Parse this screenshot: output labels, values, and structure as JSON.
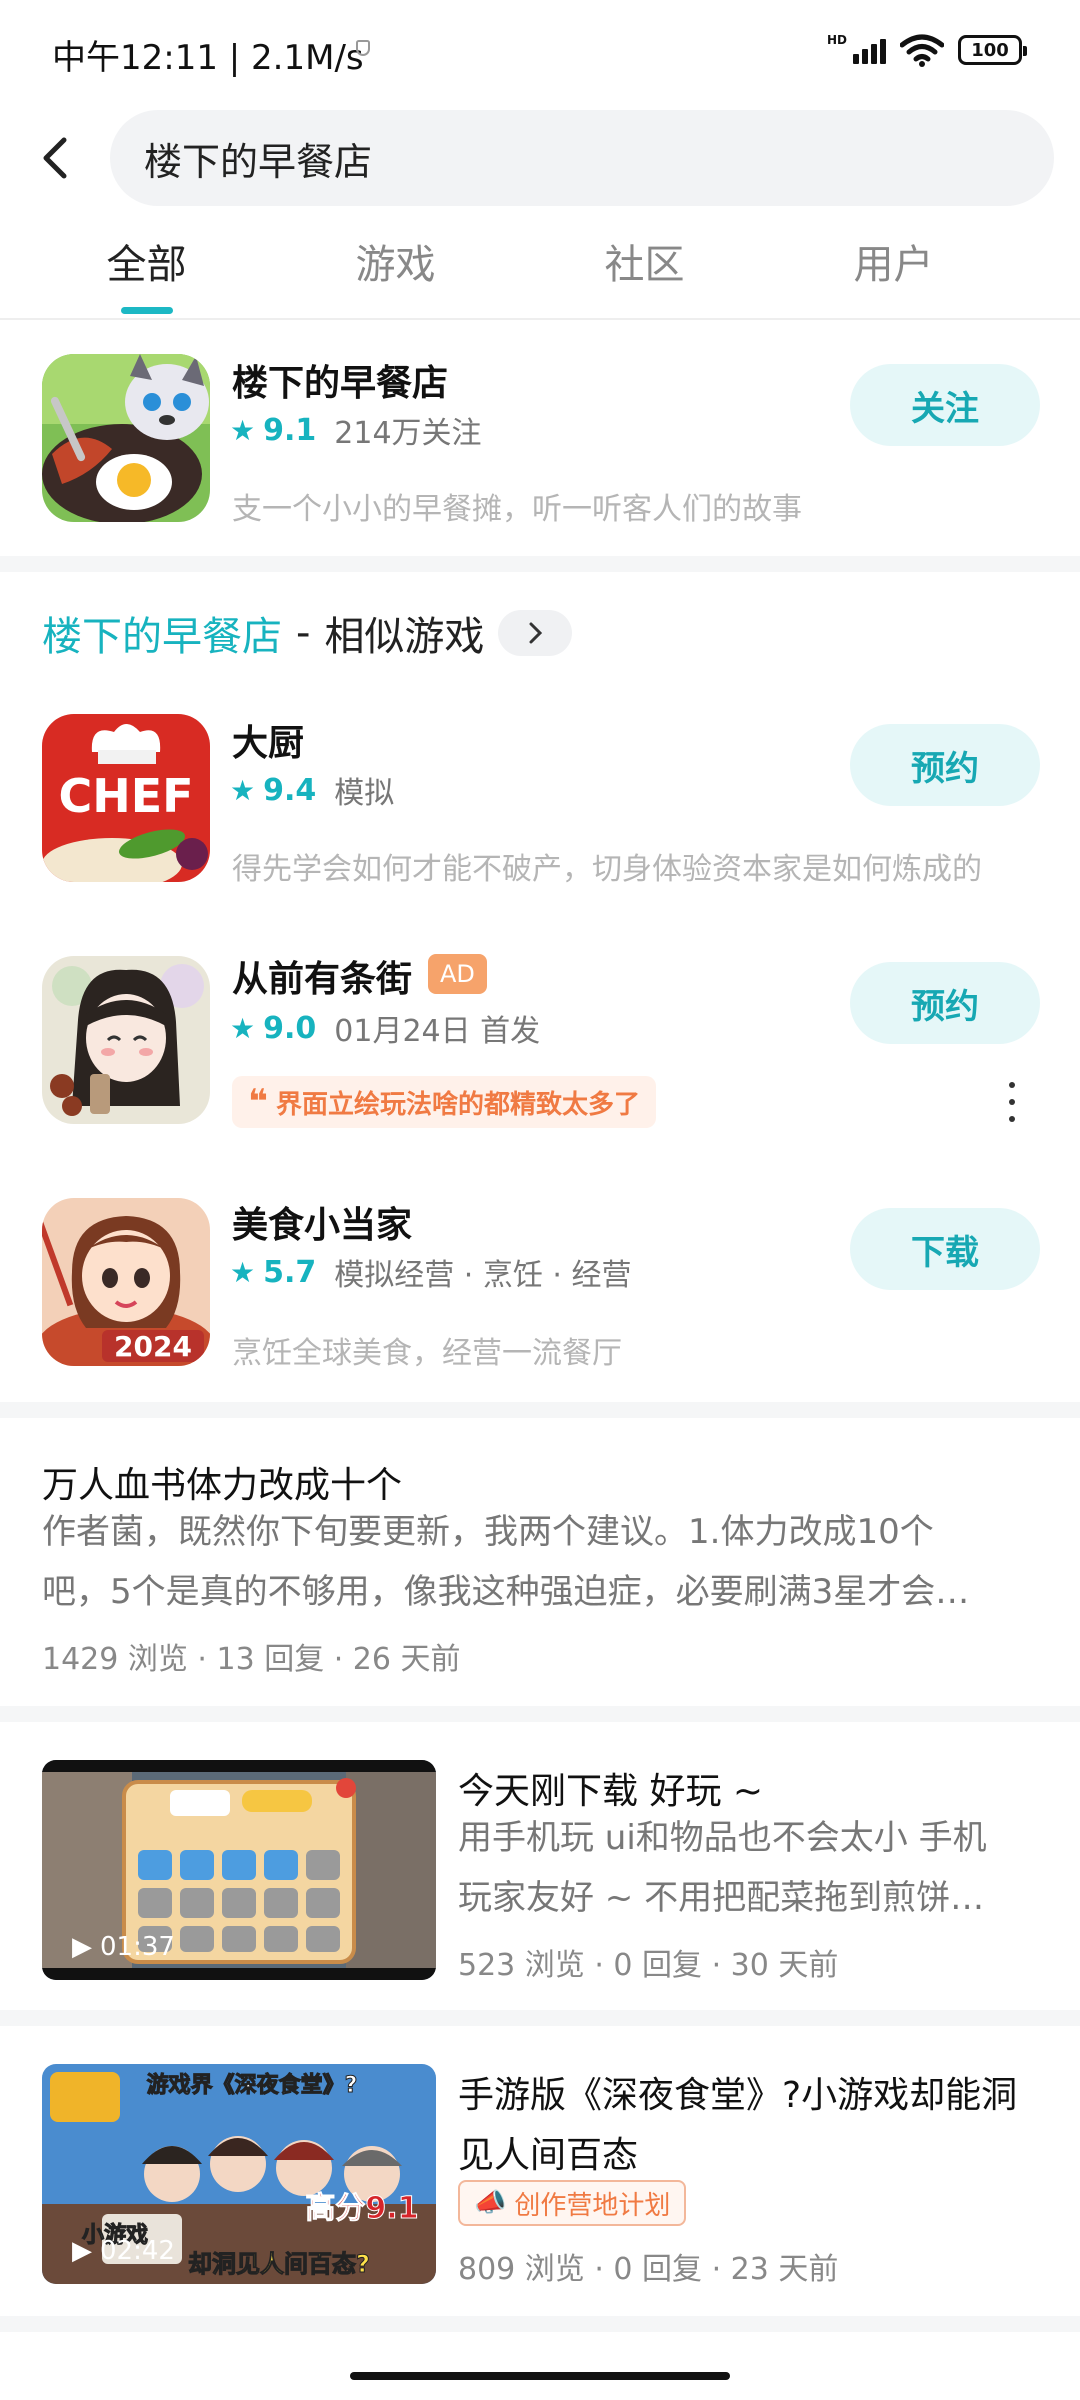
{
  "status_bar": {
    "time": "中午12:11 | 2.1M/s",
    "network": "HD",
    "battery": "100"
  },
  "search": {
    "query": "楼下的早餐店"
  },
  "tabs": [
    {
      "label": "全部",
      "active": true
    },
    {
      "label": "游戏",
      "active": false
    },
    {
      "label": "社区",
      "active": false
    },
    {
      "label": "用户",
      "active": false
    }
  ],
  "main_game": {
    "title": "楼下的早餐店",
    "rating": "9.1",
    "followers": "214万关注",
    "description": "支一个小小的早餐摊，听一听客人们的故事",
    "button": "关注"
  },
  "similar": {
    "game_name": "楼下的早餐店",
    "dash": "-",
    "suffix": "相似游戏",
    "items": [
      {
        "title": "大厨",
        "rating": "9.4",
        "meta": "模拟",
        "description": "得先学会如何才能不破产，切身体验资本家是如何炼成的",
        "button": "预约",
        "icon_text": "CHEF"
      },
      {
        "title": "从前有条街",
        "ad": "AD",
        "rating": "9.0",
        "meta": "01月24日 首发",
        "quote": "界面立绘玩法啥的都精致太多了",
        "button": "预约"
      },
      {
        "title": "美食小当家",
        "rating": "5.7",
        "meta": "模拟经营 · 烹饪 · 经营",
        "description": "烹饪全球美食，经营一流餐厅",
        "button": "下载",
        "icon_text": "2024"
      }
    ]
  },
  "posts": [
    {
      "title": "万人血书体力改成十个",
      "body_line1": "作者菌，既然你下旬要更新，我两个建议。1.体力改成10个",
      "body_line2": "吧，5个是真的不够用，像我这种强迫症，必要刷满3星才会…",
      "stats": "1429 浏览  ·  13 回复  ·  26 天前"
    },
    {
      "title": "今天刚下载 好玩 ~",
      "body_line1": "用手机玩 ui和物品也不会太小 手机",
      "body_line2": "玩家友好 ~  不用把配菜拖到煎饼…",
      "stats": "523 浏览  ·  0 回复  ·  30 天前",
      "duration": "01:37"
    },
    {
      "title_line1": "手游版《深夜食堂》?小游戏却能洞",
      "title_line2": "见人间百态",
      "chip": "创作营地计划",
      "stats": "809 浏览  ·  0 回复  ·  23 天前",
      "duration": "02:42",
      "thumb_text": {
        "top": "游戏界《深夜食堂》?",
        "score": "高分9.1",
        "bottom1": "小游戏",
        "bottom2": "却洞见人间百态?"
      }
    }
  ],
  "colors": {
    "accent": "#17b3bf",
    "ad": "#f6a36b",
    "quote": "#f07a43"
  }
}
